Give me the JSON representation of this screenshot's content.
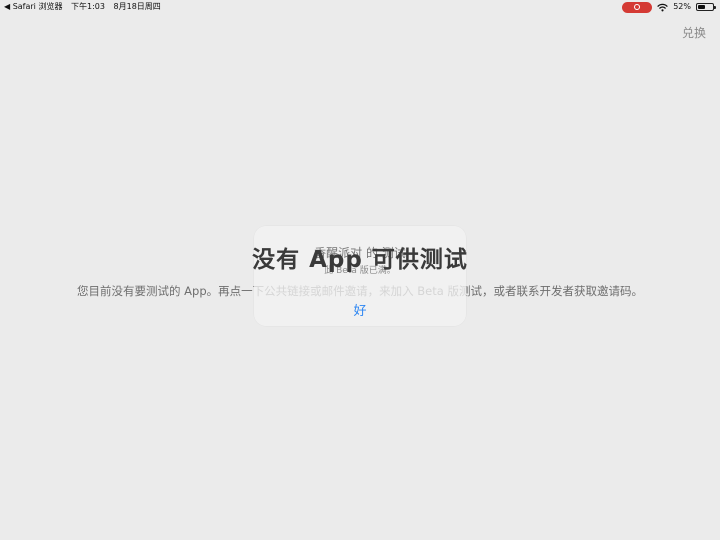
{
  "status_bar": {
    "back_label": "◀ Safari 浏览器",
    "time": "下午1:03",
    "date": "8月18日周四",
    "battery_percent": "52%",
    "battery_level": 0.52,
    "colors": {
      "record_pill": "#d43a34"
    }
  },
  "nav": {
    "redeem_label": "兑换"
  },
  "empty_state": {
    "title": "没有 App 可供测试",
    "description": "您目前没有要测试的 App。再点一下公共链接或邮件邀请，来加入 Beta 版测试，或者联系开发者获取邀请码。"
  },
  "alert": {
    "title": "香醒派对 的 测试",
    "message": "此 Beta 版已满。",
    "ok_label": "好",
    "colors": {
      "button": "#2d86f2"
    }
  }
}
